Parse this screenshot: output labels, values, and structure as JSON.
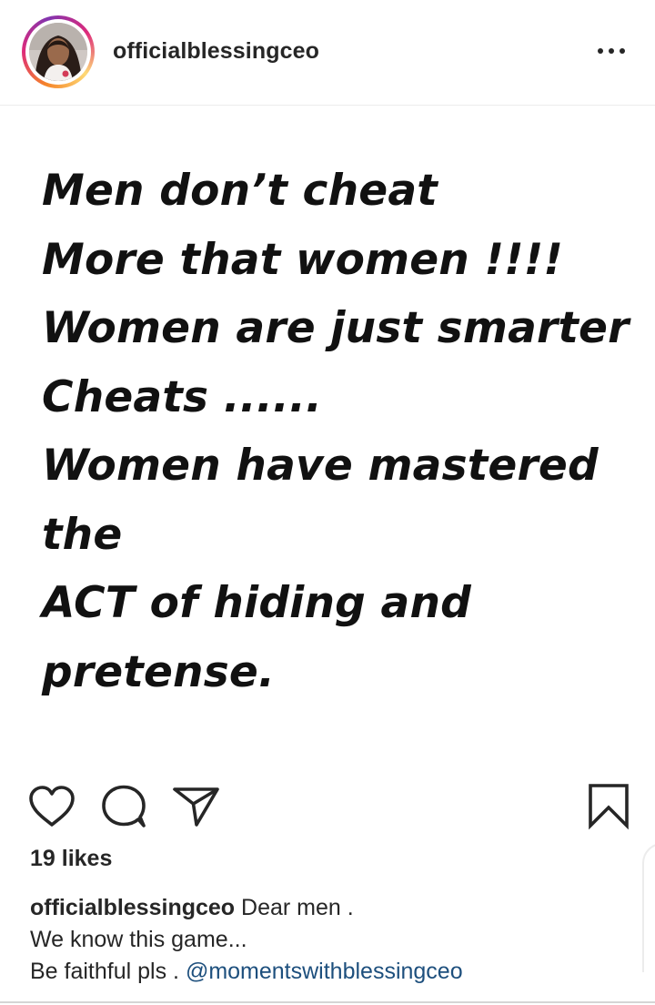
{
  "post": {
    "username": "officialblessingceo",
    "image_text": [
      "Men don’t cheat",
      "More that women !!!!",
      "Women are just smarter",
      "Cheats ......",
      "Women have mastered",
      "the",
      "ACT of hiding and",
      "pretense."
    ],
    "likes": "19 likes",
    "caption": {
      "username": "officialblessingceo",
      "line1": " Dear men .",
      "line2": "We know this game...",
      "line3": "Be faithful pls . ",
      "mention": "@momentswithblessingceo"
    }
  },
  "icons": {
    "more": "more-icon",
    "like": "heart-icon",
    "comment": "comment-icon",
    "share": "send-icon",
    "save": "bookmark-icon"
  },
  "colors": {
    "text": "#262626",
    "mention": "#1d4f7d",
    "story_ring_start": "#f58529",
    "story_ring_end": "#dd2a7b"
  }
}
